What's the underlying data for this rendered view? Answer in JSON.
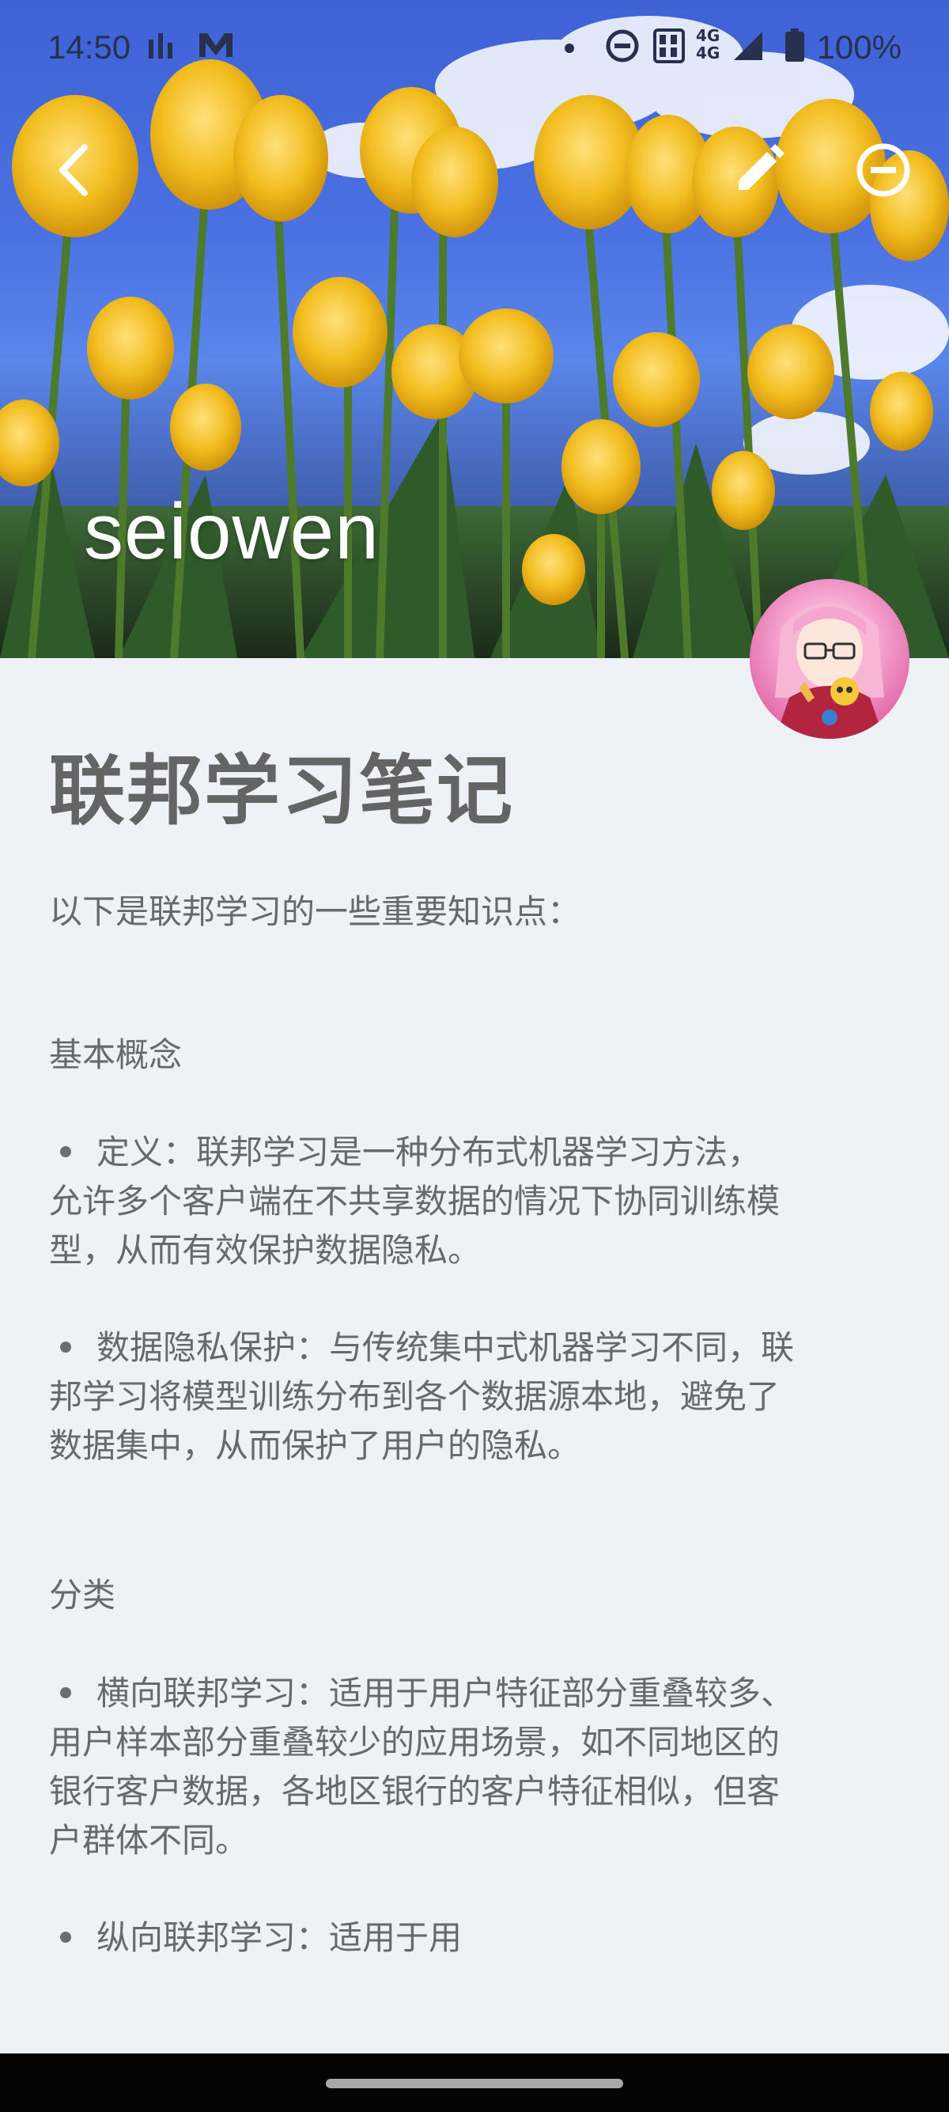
{
  "status_bar": {
    "time": "14:50",
    "battery": "100%",
    "network": "4G",
    "icons": [
      "signal-bars-icon",
      "mail-m-icon",
      "dot-icon",
      "do-not-disturb-icon",
      "hd-icon",
      "4g-icon",
      "cell-signal-icon",
      "battery-icon"
    ]
  },
  "toolbar": {
    "back_icon": "back-arrow-icon",
    "edit_icon": "pencil-icon",
    "remove_icon": "minus-circle-icon"
  },
  "header": {
    "author": "seiowen",
    "avatar_icon": "anime-avatar"
  },
  "article": {
    "title": "联邦学习笔记",
    "intro": "以下是联邦学习的一些重要知识点：",
    "section1_heading": "基本概念",
    "s1_b1_line1": "定义：联邦学习是一种分布式机器学习方法，",
    "s1_b1_line2": "允许多个客户端在不共享数据的情况下协同训练模",
    "s1_b1_line3": "型，从而有效保护数据隐私。",
    "s1_b2_line1": "数据隐私保护：与传统集中式机器学习不同，联",
    "s1_b2_line2": "邦学习将模型训练分布到各个数据源本地，避免了",
    "s1_b2_line3": "数据集中，从而保护了用户的隐私。",
    "section2_heading": "分类",
    "s2_b1_line1": "横向联邦学习：适用于用户特征部分重叠较多、",
    "s2_b1_line2": "用户样本部分重叠较少的应用场景，如不同地区的",
    "s2_b1_line3": "银行客户数据，各地区银行的客户特征相似，但客",
    "s2_b1_line4": "户群体不同。",
    "s2_b2_line1": "纵向联邦学习：适用于用"
  },
  "colors": {
    "background": "#eef1f5",
    "title": "#646464",
    "body_text": "#666a6f",
    "nav_bar": "#050505"
  }
}
